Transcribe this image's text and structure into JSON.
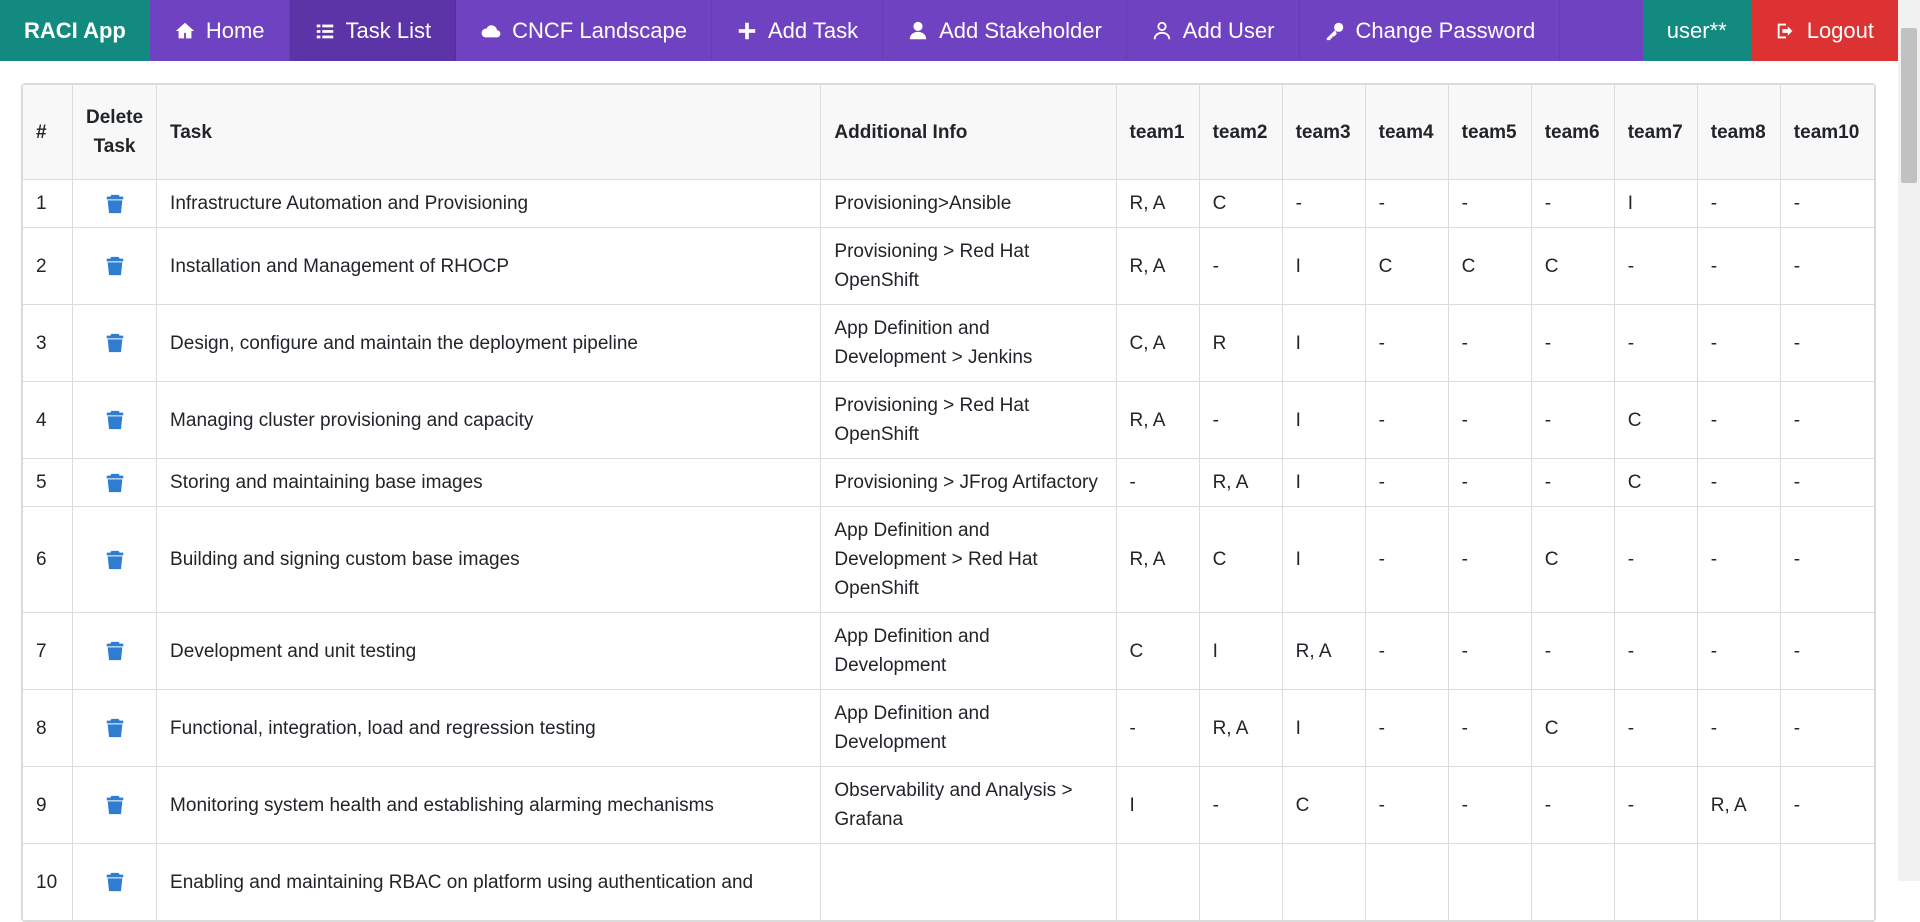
{
  "navbar": {
    "brand": "RACI App",
    "items": [
      {
        "label": "Home",
        "icon": "home-icon"
      },
      {
        "label": "Task List",
        "icon": "list-icon",
        "active": true
      },
      {
        "label": "CNCF Landscape",
        "icon": "cloud-icon"
      },
      {
        "label": "Add Task",
        "icon": "plus-icon"
      },
      {
        "label": "Add Stakeholder",
        "icon": "user-icon"
      },
      {
        "label": "Add User",
        "icon": "user-outline-icon"
      },
      {
        "label": "Change Password",
        "icon": "key-icon"
      }
    ],
    "user": "user**",
    "logout": "Logout",
    "colors": {
      "nav": "#6f42c1",
      "brand": "#138a80",
      "logout": "#dc3232"
    }
  },
  "table": {
    "headers": [
      "#",
      "Delete Task",
      "Task",
      "Additional Info",
      "team1",
      "team2",
      "team3",
      "team4",
      "team5",
      "team6",
      "team7",
      "team8",
      "team10"
    ],
    "rows": [
      {
        "num": "1",
        "task": "Infrastructure Automation and Provisioning",
        "info": "Provisioning>Ansible",
        "teams": [
          "R, A",
          "C",
          "-",
          "-",
          "-",
          "-",
          "I",
          "-",
          "-"
        ]
      },
      {
        "num": "2",
        "task": "Installation and Management of RHOCP",
        "info": "Provisioning > Red Hat OpenShift",
        "teams": [
          "R, A",
          "-",
          "I",
          "C",
          "C",
          "C",
          "-",
          "-",
          "-"
        ]
      },
      {
        "num": "3",
        "task": "Design, configure and maintain the deployment pipeline",
        "info": "App Definition and Development > Jenkins",
        "teams": [
          "C, A",
          "R",
          "I",
          "-",
          "-",
          "-",
          "-",
          "-",
          "-"
        ]
      },
      {
        "num": "4",
        "task": "Managing cluster provisioning and capacity",
        "info": "Provisioning > Red Hat OpenShift",
        "teams": [
          "R, A",
          "-",
          "I",
          "-",
          "-",
          "-",
          "C",
          "-",
          "-"
        ]
      },
      {
        "num": "5",
        "task": "Storing and maintaining base images",
        "info": "Provisioning > JFrog Artifactory",
        "teams": [
          "-",
          "R, A",
          "I",
          "-",
          "-",
          "-",
          "C",
          "-",
          "-"
        ]
      },
      {
        "num": "6",
        "task": "Building and signing custom base images",
        "info": "App Definition and Development > Red Hat OpenShift",
        "teams": [
          "R, A",
          "C",
          "I",
          "-",
          "-",
          "C",
          "-",
          "-",
          "-"
        ]
      },
      {
        "num": "7",
        "task": "Development and unit testing",
        "info": "App Definition and Development",
        "teams": [
          "C",
          "I",
          "R, A",
          "-",
          "-",
          "-",
          "-",
          "-",
          "-"
        ]
      },
      {
        "num": "8",
        "task": "Functional, integration, load and regression testing",
        "info": "App Definition and Development",
        "teams": [
          "-",
          "R, A",
          "I",
          "-",
          "-",
          "C",
          "-",
          "-",
          "-"
        ]
      },
      {
        "num": "9",
        "task": "Monitoring system health and establishing alarming mechanisms",
        "info": "Observability and Analysis > Grafana",
        "teams": [
          "I",
          "-",
          "C",
          "-",
          "-",
          "-",
          "-",
          "R, A",
          "-"
        ]
      },
      {
        "num": "10",
        "task": "Enabling and maintaining RBAC on platform using authentication and",
        "info": "",
        "teams": [
          "",
          "",
          "",
          "",
          "",
          "",
          "",
          "",
          ""
        ]
      }
    ]
  }
}
